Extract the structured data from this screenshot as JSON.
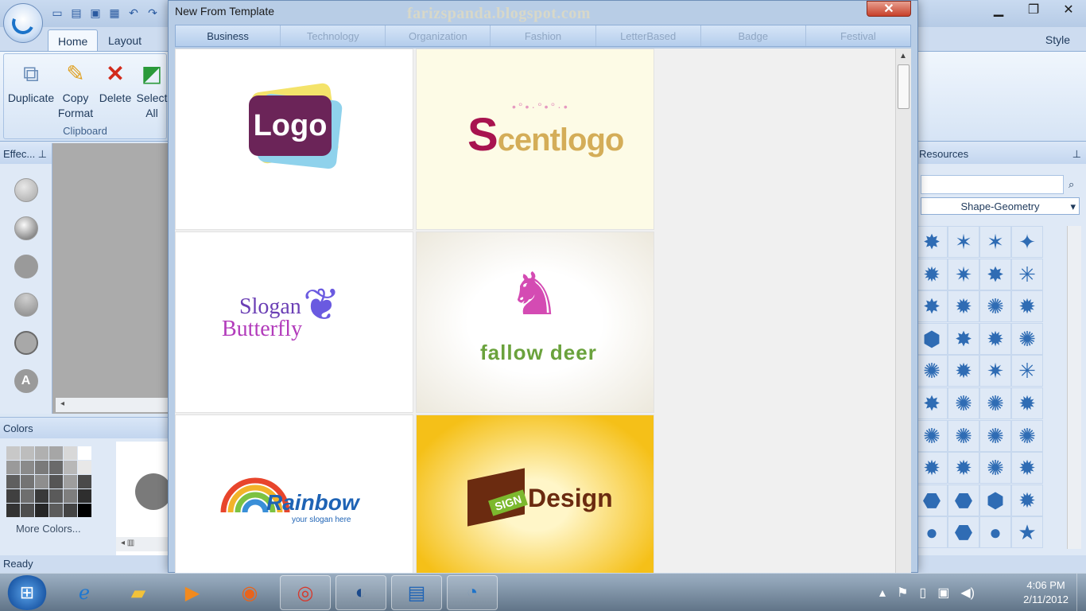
{
  "app": {
    "tabs": [
      "Home",
      "Layout"
    ],
    "right_tab": "Style",
    "clipboard": {
      "group_label": "Clipboard",
      "buttons": [
        {
          "label": "Duplicate",
          "icon": "duplicate-icon"
        },
        {
          "label": "Copy Format",
          "icon": "paintbrush-icon"
        },
        {
          "label": "Delete",
          "icon": "delete-x-icon"
        },
        {
          "label": "Select All",
          "icon": "select-shapes-icon"
        }
      ]
    },
    "effects_panel": {
      "title": "Effec..."
    },
    "colors_panel": {
      "title": "Colors",
      "more_colors": "More Colors..."
    },
    "resources_panel": {
      "title": "Resources",
      "category": "Shape-Geometry"
    },
    "status": "Ready"
  },
  "dialog": {
    "title": "New From Template",
    "watermark": "farizspanda.blogspot.com",
    "tabs": [
      "Business",
      "Technology",
      "Organization",
      "Fashion",
      "LetterBased",
      "Badge",
      "Festival"
    ],
    "active_tab": "Business",
    "templates": [
      {
        "text": "Logo"
      },
      {
        "text": "Scentlogo",
        "first_letter": "S",
        "rest": "centlogo"
      },
      {
        "line1": "Slogan",
        "line2": "Butterfly"
      },
      {
        "text": "fallow deer"
      },
      {
        "text": "Rainbow",
        "sub": "your slogan here"
      },
      {
        "badge": "SIGN",
        "text": "Design"
      }
    ]
  },
  "taskbar": {
    "time": "4:06 PM",
    "date": "2/11/2012"
  },
  "colors": {
    "accent": "#1e63b5",
    "dialog_bg": "#b8cde6",
    "close_red": "#c7402a"
  }
}
